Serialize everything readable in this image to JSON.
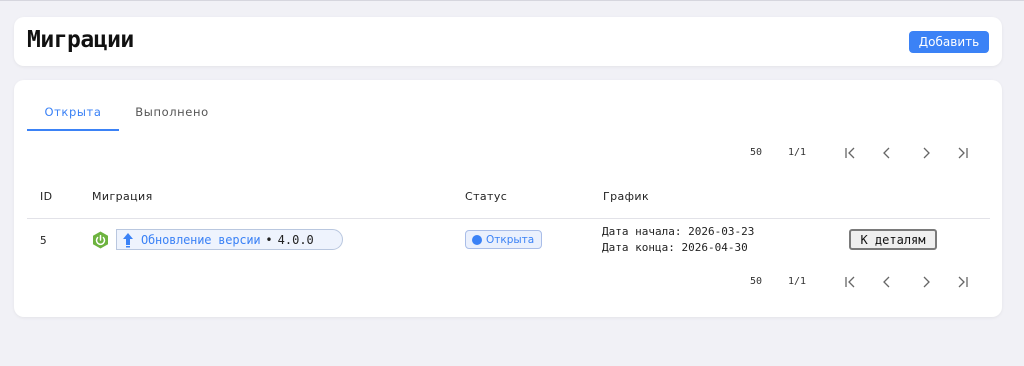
{
  "header": {
    "title": "Миграции",
    "add_label": "Добавить"
  },
  "tabs": [
    {
      "label": "Открыта",
      "active": true
    },
    {
      "label": "Выполнено",
      "active": false
    }
  ],
  "pagination": {
    "per_page": "50",
    "page_info": "1/1"
  },
  "table": {
    "columns": [
      "ID",
      "Миграция",
      "Статус",
      "График"
    ],
    "rows": [
      {
        "id": "5",
        "migration_icon": "spring-power-icon",
        "migration_label": "Обновление версии",
        "migration_separator": "•",
        "migration_version": "4.0.0",
        "status": "Открыта",
        "start_date": "Дата начала: 2026-03-23",
        "end_date": "Дата конца: 2026-04-30",
        "details_label": "К деталям"
      }
    ]
  },
  "colors": {
    "accent": "#3b82f6",
    "spring_green": "#6db33f",
    "background": "#f1f1f6"
  }
}
